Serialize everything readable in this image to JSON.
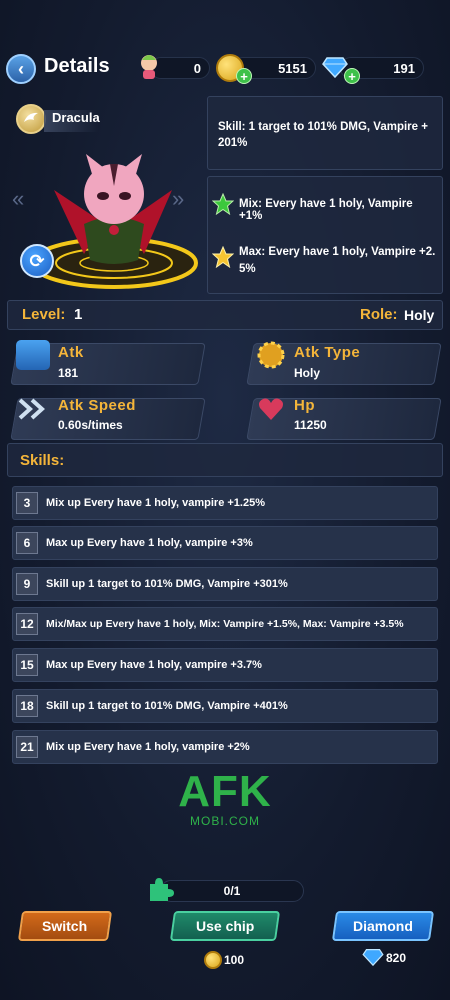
{
  "header": {
    "title": "Details",
    "resources": [
      {
        "icon": "hero-token-icon",
        "value": "0"
      },
      {
        "icon": "gold-coin-icon",
        "value": "5151"
      },
      {
        "icon": "diamond-icon",
        "value": "191"
      }
    ]
  },
  "hero": {
    "name": "Dracula",
    "skill": "Skill: 1 target to 101% DMG, Vampire + 201%",
    "mix": "Mix: Every have 1 holy, Vampire +1%",
    "max": "Max: Every have 1 holy, Vampire +2. 5%"
  },
  "level_bar": {
    "level_label": "Level:",
    "level": "1",
    "role_label": "Role:",
    "role": "Holy"
  },
  "stats": [
    {
      "label": "Atk",
      "value": "181"
    },
    {
      "label": "Atk Type",
      "value": "Holy"
    },
    {
      "label": "Atk Speed",
      "value": "0.60s/times"
    },
    {
      "label": "Hp",
      "value": "11250"
    }
  ],
  "skills_header": "Skills:",
  "skills": [
    {
      "level": "3",
      "text": "Mix up Every have 1 holy, vampire +1.25%"
    },
    {
      "level": "6",
      "text": "Max up Every have 1 holy, vampire +3%"
    },
    {
      "level": "9",
      "text": "Skill up 1 target to 101% DMG, Vampire +301%"
    },
    {
      "level": "12",
      "text": "Mix/Max up Every have 1 holy, Mix: Vampire +1.5%, Max: Vampire +3.5%"
    },
    {
      "level": "15",
      "text": "Max up Every have 1 holy, vampire +3.7%"
    },
    {
      "level": "18",
      "text": "Skill up 1 target to 101% DMG, Vampire +401%"
    },
    {
      "level": "21",
      "text": "Mix up Every have 1 holy, vampire +2%"
    }
  ],
  "watermark": {
    "line1": "AFK",
    "line2": "MOBI.COM"
  },
  "chip_progress": "0/1",
  "buttons": {
    "switch": "Switch",
    "use_chip": "Use chip",
    "diamond": "Diamond"
  },
  "costs": {
    "chip_gold": "100",
    "diamond": "820"
  }
}
